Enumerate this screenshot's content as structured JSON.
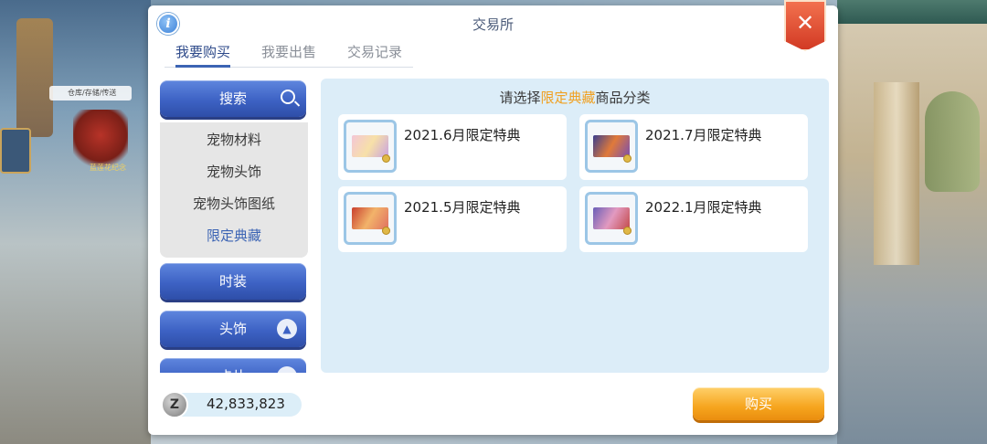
{
  "backdrop": {
    "npc_tag": "仓库/存储/传送",
    "player_name": "蓝莲花纪念"
  },
  "dialog": {
    "title": "交易所",
    "info_icon": "i",
    "close_icon": "✕"
  },
  "tabs": [
    {
      "label": "我要购买",
      "active": true
    },
    {
      "label": "我要出售",
      "active": false
    },
    {
      "label": "交易记录",
      "active": false
    }
  ],
  "categories": {
    "search_label": "搜索",
    "sub_items": [
      "宠物材料",
      "宠物头饰",
      "宠物头饰图纸",
      "限定典藏"
    ],
    "active_sub_item": "限定典藏",
    "fashion_label": "时装",
    "headwear_label": "头饰",
    "card_label": "卡片"
  },
  "list": {
    "prompt_prefix": "请选择",
    "prompt_highlight": "限定典藏",
    "prompt_suffix": "商品分类",
    "highlight_color": "#f0a020",
    "items": [
      {
        "label": "2021.6月限定特典"
      },
      {
        "label": "2021.7月限定特典"
      },
      {
        "label": "2021.5月限定特典"
      },
      {
        "label": "2022.1月限定特典"
      }
    ]
  },
  "footer": {
    "zeny_icon": "Z",
    "zeny_amount": "42,833,823",
    "buy_label": "购买"
  },
  "colors": {
    "accent_blue": "#3d62c4",
    "buy_orange": "#f6a51e",
    "close_red": "#d23a24"
  }
}
